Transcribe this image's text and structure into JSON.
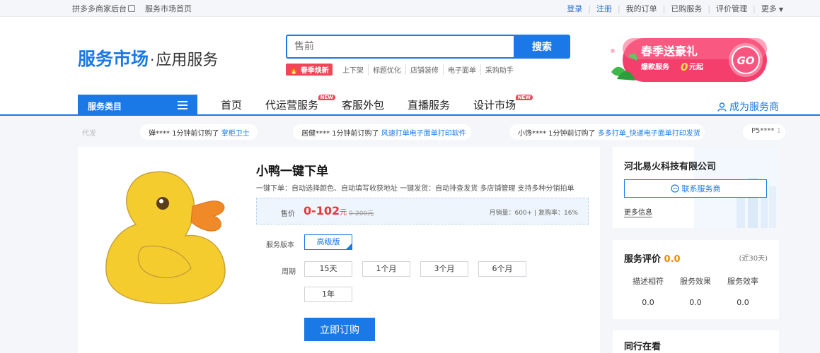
{
  "topbar": {
    "left": [
      "拼多多商家后台",
      "服务市场首页"
    ],
    "login": "登录",
    "register": "注册",
    "my_orders": "我的订单",
    "bought": "已购服务",
    "reviews": "评价管理",
    "more": "更多"
  },
  "logo": {
    "main": "服务市场",
    "dot": "·",
    "sub": "应用服务"
  },
  "search": {
    "placeholder": "售前",
    "button": "搜索",
    "hot_tag": "春季焕新",
    "hot_words": [
      "上下架",
      "标题优化",
      "店铺装修",
      "电子面单",
      "采购助手"
    ]
  },
  "promo": {
    "title": "春季送豪礼",
    "sub_prefix": "爆款服务",
    "sub_num": "0",
    "sub_suffix": "元起",
    "go": "GO"
  },
  "nav": {
    "category": "服务类目",
    "items": [
      {
        "label": "首页",
        "new": ""
      },
      {
        "label": "代运营服务",
        "new": "NEW"
      },
      {
        "label": "客服外包",
        "new": ""
      },
      {
        "label": "直播服务",
        "new": ""
      },
      {
        "label": "设计市场",
        "new": "NEW"
      }
    ],
    "become": "成为服务商"
  },
  "ticker": [
    {
      "user": "",
      "text": "代发",
      "link": ""
    },
    {
      "user": "婵****",
      "text": " 1分钟前订购了 ",
      "link": "掌柜卫士"
    },
    {
      "user": "居健****",
      "text": " 1分钟前订购了 ",
      "link": "风速打单电子面单打印软件"
    },
    {
      "user": "小馋****",
      "text": " 1分钟前订购了 ",
      "link": "多多打单_快递电子面单打印发货"
    },
    {
      "user": "P5****",
      "text": " 1",
      "link": ""
    }
  ],
  "product": {
    "title": "小鸭一键下单",
    "desc": "一键下单：自动选择颜色、自动填写收获地址 一键发货：自动排查发货 多店铺管理 支持多种分销拍单",
    "price_label": "售价",
    "price": "0-102",
    "price_unit": "元",
    "orig_price": "0-200元",
    "monthly_sales": "月销量：600+",
    "repurchase": "复购率：16%",
    "edition_label": "服务版本",
    "edition": "高级版",
    "period_label": "周期",
    "periods": [
      "15天",
      "1个月",
      "3个月",
      "6个月",
      "1年"
    ],
    "buy": "立即订购"
  },
  "shop": {
    "name": "河北易火科技有限公司",
    "contact": "联系服务商",
    "more": "更多信息"
  },
  "evaluation": {
    "title": "服务评价",
    "score": "0.0",
    "days": "(近30天)",
    "metrics": [
      {
        "label": "描述相符",
        "value": "0.0"
      },
      {
        "label": "服务效果",
        "value": "0.0"
      },
      {
        "label": "服务效率",
        "value": "0.0"
      }
    ]
  },
  "peer": {
    "title": "同行在看"
  },
  "colors": {
    "accent": "#1a79e6",
    "price": "#e4393c",
    "score": "#f08a00",
    "duck": "#f5cc2e",
    "beak": "#f08a28"
  },
  "icons": [
    "external-link-icon",
    "menu-icon",
    "user-icon",
    "chat-icon",
    "duck-image"
  ]
}
